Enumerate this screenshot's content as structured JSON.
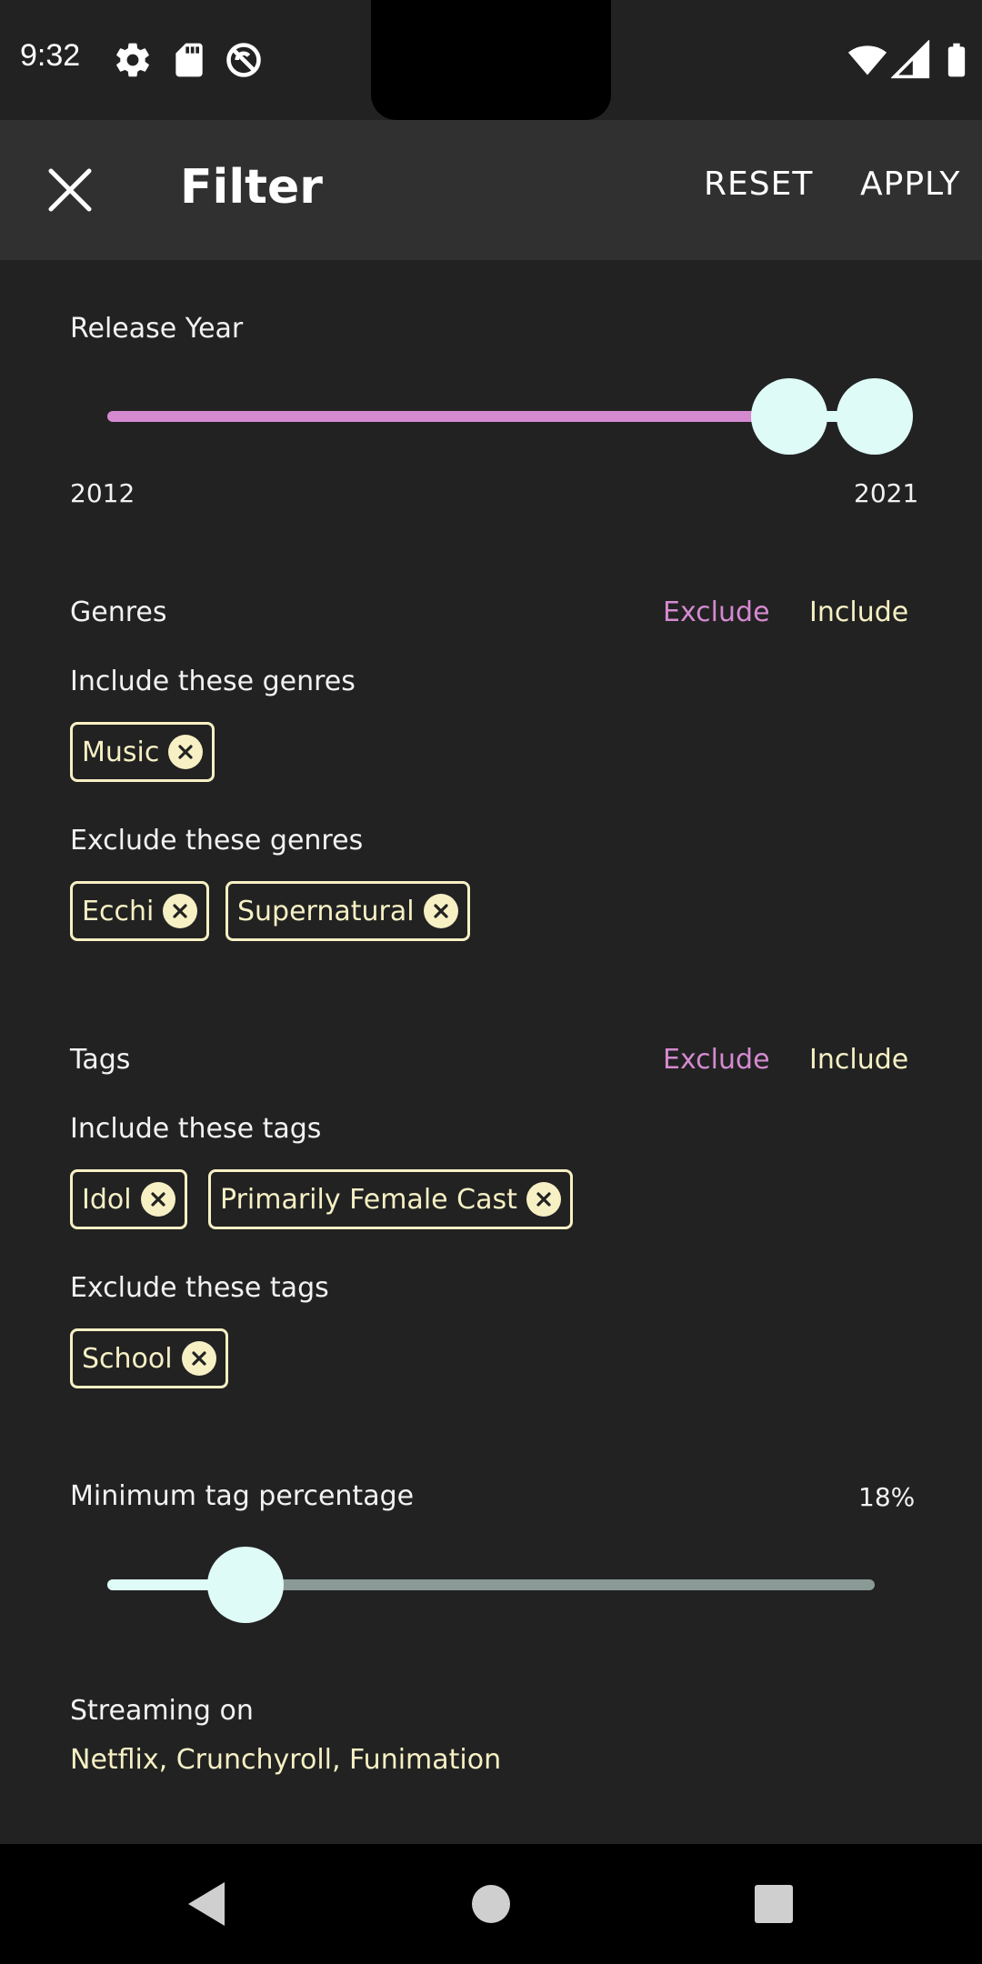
{
  "status_bar": {
    "time": "9:32"
  },
  "app_bar": {
    "title": "Filter",
    "reset_label": "RESET",
    "apply_label": "APPLY"
  },
  "release_year": {
    "label": "Release Year",
    "min_label": "2012",
    "max_label": "2021",
    "range_min": 2012,
    "range_max": 2021,
    "selected_start": 2020,
    "selected_end": 2021
  },
  "genres": {
    "title": "Genres",
    "exclude_label": "Exclude",
    "include_label": "Include",
    "include_heading": "Include these genres",
    "include_chips": [
      "Music"
    ],
    "exclude_heading": "Exclude these genres",
    "exclude_chips": [
      "Ecchi",
      "Supernatural"
    ]
  },
  "tags": {
    "title": "Tags",
    "exclude_label": "Exclude",
    "include_label": "Include",
    "include_heading": "Include these tags",
    "include_chips": [
      "Idol",
      "Primarily Female Cast"
    ],
    "exclude_heading": "Exclude these tags",
    "exclude_chips": [
      "School"
    ]
  },
  "min_tag_percentage": {
    "label": "Minimum tag percentage",
    "value_label": "18%",
    "value": 18
  },
  "streaming": {
    "label": "Streaming on",
    "services": "Netflix, Crunchyroll, Funimation"
  },
  "colors": {
    "accent_pink": "#d58ad0",
    "accent_cream": "#f6f0c4",
    "thumb": "#dffbf7",
    "background": "#222222"
  }
}
